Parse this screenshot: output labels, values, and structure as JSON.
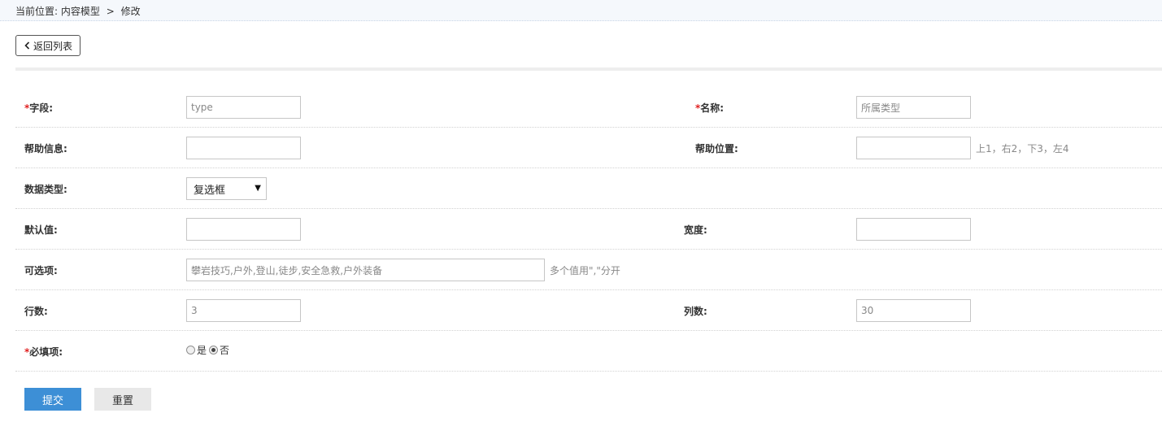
{
  "breadcrumb": {
    "prefix": "当前位置:",
    "section": "内容模型",
    "separator": ">",
    "current": "修改"
  },
  "back_button": {
    "label": "返回列表",
    "icon": "chevron-left-icon"
  },
  "colors": {
    "required": "#e02020",
    "submit_bg": "#3d8fd6",
    "reset_bg": "#e8e8e8",
    "topbar_bg": "#f5f8fc"
  },
  "form": {
    "required_mark": "*",
    "field": {
      "label": "字段:",
      "value": "type"
    },
    "name": {
      "label": "名称:",
      "value": "所属类型"
    },
    "help_info": {
      "label": "帮助信息:",
      "value": ""
    },
    "help_position": {
      "label": "帮助位置:",
      "value": "",
      "hint": "上1，右2，下3，左4"
    },
    "data_type": {
      "label": "数据类型:",
      "selected": "复选框"
    },
    "default_value": {
      "label": "默认值:",
      "value": ""
    },
    "width": {
      "label": "宽度:",
      "value": ""
    },
    "options": {
      "label": "可选项:",
      "value": "攀岩技巧,户外,登山,徒步,安全急救,户外装备",
      "hint": "多个值用\",\"分开"
    },
    "rows": {
      "label": "行数:",
      "value": "3"
    },
    "cols": {
      "label": "列数:",
      "value": "30"
    },
    "required_field": {
      "label": "必填项:",
      "options": [
        {
          "label": "是",
          "checked": false
        },
        {
          "label": "否",
          "checked": true
        }
      ]
    }
  },
  "actions": {
    "submit": "提交",
    "reset": "重置"
  }
}
